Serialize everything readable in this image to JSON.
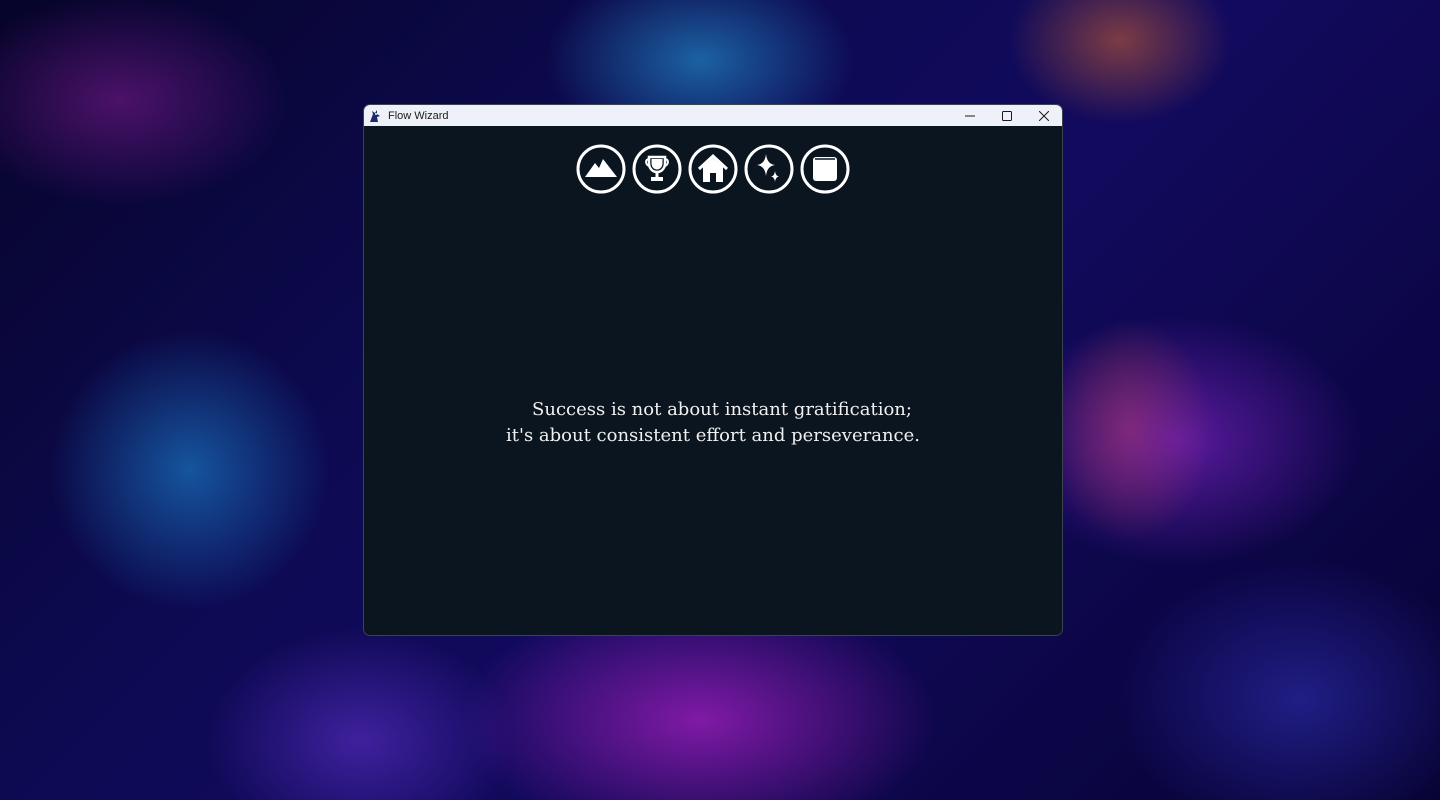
{
  "window": {
    "title": "Flow Wizard",
    "app_icon": "wizard-icon"
  },
  "controls": {
    "minimize_icon": "minimize-icon",
    "maximize_icon": "maximize-icon",
    "close_icon": "close-icon"
  },
  "nav_icons": [
    {
      "name": "mountain-icon"
    },
    {
      "name": "trophy-icon"
    },
    {
      "name": "home-icon"
    },
    {
      "name": "sparkle-icon"
    },
    {
      "name": "square-icon"
    }
  ],
  "quote": {
    "line1": "Success is not about instant gratification;",
    "line2": "it's about consistent effort and perseverance."
  },
  "colors": {
    "window_bg": "#0a1520",
    "titlebar_bg": "#eef2f8",
    "icon_stroke": "#ffffff",
    "text": "#f0f0f0"
  }
}
